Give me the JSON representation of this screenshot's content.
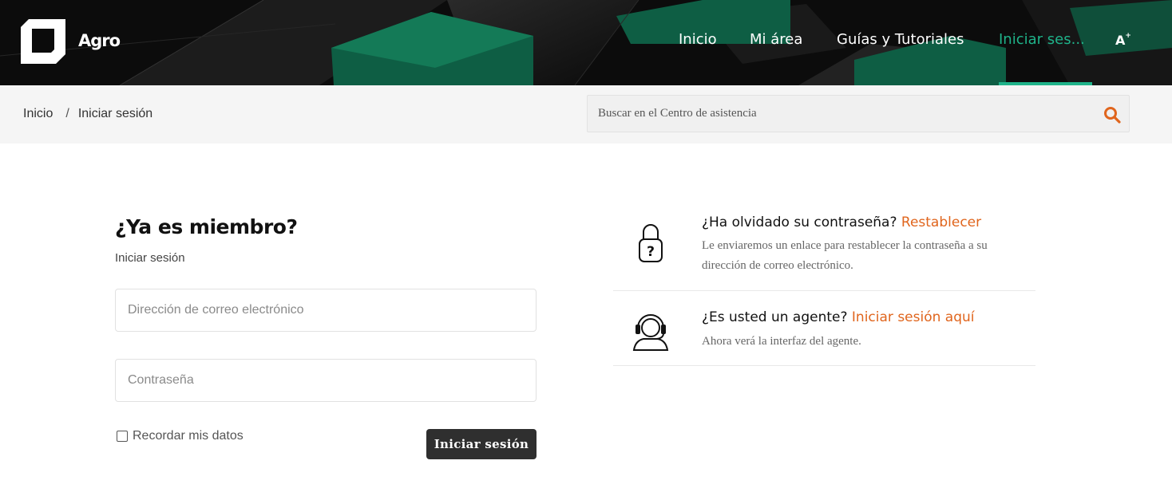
{
  "header": {
    "brand": "Agro",
    "nav": [
      {
        "label": "Inicio",
        "active": false
      },
      {
        "label": "Mi área",
        "active": false
      },
      {
        "label": "Guías y Tutoriales",
        "active": false
      },
      {
        "label": "Iniciar ses...",
        "active": true
      }
    ],
    "font_size_button": "A",
    "font_size_plus": "+",
    "accent_color": "#1fb38a"
  },
  "breadcrumb": {
    "items": [
      "Inicio",
      "Iniciar sesión"
    ],
    "separator": "/"
  },
  "search": {
    "placeholder": "Buscar en el Centro de asistencia",
    "icon": "search-icon",
    "icon_color": "#e0651d"
  },
  "login": {
    "title": "¿Ya es miembro?",
    "subtitle": "Iniciar sesión",
    "email_placeholder": "Dirección de correo electrónico",
    "password_placeholder": "Contraseña",
    "remember_label": "Recordar mis datos",
    "remember_checked": false,
    "submit_label": "Iniciar sesión"
  },
  "info": {
    "forgot": {
      "icon": "padlock-question-icon",
      "question": "¿Ha olvidado su contraseña? ",
      "link": "Restablecer",
      "description": "Le enviaremos un enlace para restablecer la contraseña a su dirección de correo electrónico."
    },
    "agent": {
      "icon": "headset-agent-icon",
      "question": "¿Es usted un agente? ",
      "link": "Iniciar sesión aquí",
      "description": "Ahora verá la interfaz del agente."
    },
    "link_color": "#e0651d"
  }
}
